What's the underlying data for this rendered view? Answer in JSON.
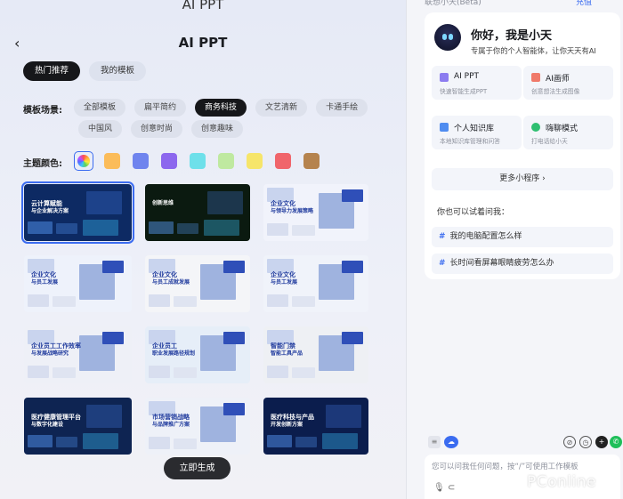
{
  "left": {
    "top_title": "AI PPT",
    "page_title": "AI PPT",
    "back_icon": "chevron-left-icon",
    "tabs": [
      {
        "label": "热门推荐",
        "active": true
      },
      {
        "label": "我的模板",
        "active": false
      }
    ],
    "scene_label": "模板场景:",
    "scenes_row1": [
      "全部模板",
      "扁平简约",
      "商务科技",
      "文艺清新",
      "卡通手绘"
    ],
    "scenes_row2": [
      "中国风",
      "创意时尚",
      "创意趣味"
    ],
    "active_scene": "商务科技",
    "color_label": "主题颜色:",
    "theme_colors": [
      "#fbbc5a",
      "#6f84ee",
      "#8c67ee",
      "#6ee0ea",
      "#bfe9a0",
      "#f6e56a",
      "#f0656b",
      "#b5834e"
    ],
    "templates": [
      {
        "lines": [
          "云计算赋能",
          "与企业解决方案"
        ],
        "style": "dark-blue",
        "bg": "#0d2a63",
        "fg": "#ffffff"
      },
      {
        "lines": [
          "创新思维"
        ],
        "style": "dark-green",
        "bg": "#0b1a10",
        "fg": "#ffffff"
      },
      {
        "lines": [
          "企业文化",
          "与领导力发展策略"
        ],
        "style": "light-purple",
        "bg": "#f1f3fb",
        "fg": "#1f3a9d"
      },
      {
        "lines": [
          "企业文化",
          "与员工发展"
        ],
        "style": "light-blue",
        "bg": "#eef2fb",
        "fg": "#1f3a9d"
      },
      {
        "lines": [
          "企业文化",
          "与员工成就发展"
        ],
        "style": "light-red",
        "bg": "#f4f5f8",
        "fg": "#1f3a9d"
      },
      {
        "lines": [
          "企业文化",
          "与员工发展"
        ],
        "style": "light-blue2",
        "bg": "#f0f3fa",
        "fg": "#1f3a9d"
      },
      {
        "lines": [
          "企业员工工作效率",
          "与发展战略研究"
        ],
        "style": "light-collage",
        "bg": "#eef0f7",
        "fg": "#1f3a9d"
      },
      {
        "lines": [
          "企业员工",
          "职业发展路径规划"
        ],
        "style": "light-sky",
        "bg": "#e6eef8",
        "fg": "#1f3a9d"
      },
      {
        "lines": [
          "智能门禁",
          "智能工具产品"
        ],
        "style": "light-grey",
        "bg": "#eef0f4",
        "fg": "#1f3a9d"
      },
      {
        "lines": [
          "医疗健康管理平台",
          "与数字化建设"
        ],
        "style": "dark-navy",
        "bg": "#0e2452",
        "fg": "#ffffff"
      },
      {
        "lines": [
          "市场营销战略",
          "与品牌推广方案"
        ],
        "style": "light-person",
        "bg": "#eef1f8",
        "fg": "#1f3a9d"
      },
      {
        "lines": [
          "医疗科技与产品",
          "开发创新方案"
        ],
        "style": "dark-tech",
        "bg": "#0b1d4d",
        "fg": "#ffffff"
      }
    ],
    "generate_label": "立即生成"
  },
  "right": {
    "top_label": "联想小天(Beta)",
    "top_right": "充值",
    "greeting": "你好，我是小天",
    "subtitle": "专属于你的个人智能体，让你天天有AI",
    "features": [
      {
        "name": "AI PPT",
        "desc": "快速智能生成PPT",
        "icon": "ppt-icon",
        "color": "#8c7cf0"
      },
      {
        "name": "AI画师",
        "desc": "创意想法生成图像",
        "icon": "paint-icon",
        "color": "#f07a6a"
      },
      {
        "name": "个人知识库",
        "desc": "本地知识库管理和问答",
        "icon": "book-icon",
        "color": "#4f8cf0"
      },
      {
        "name": "嗨聊模式",
        "desc": "打电话给小天",
        "icon": "phone-icon",
        "color": "#2fbf71"
      }
    ],
    "more_label": "更多小程序 ›",
    "try_label": "你也可以试着问我：",
    "questions": [
      "我的电脑配置怎么样",
      "长时间看屏幕眼睛疲劳怎么办"
    ],
    "input_placeholder": "您可以问我任何问题，按“/”可使用工作模板",
    "watermark": "PConline"
  }
}
